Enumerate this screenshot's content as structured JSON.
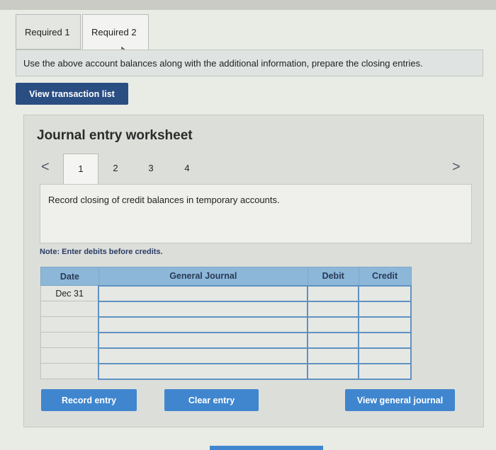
{
  "tabs": [
    {
      "label": "Required 1"
    },
    {
      "label": "Required 2"
    }
  ],
  "instruction": "Use the above account balances along with the additional information, prepare the closing entries.",
  "view_transaction_button": "View transaction list",
  "worksheet": {
    "title": "Journal entry worksheet",
    "nav_prev": "<",
    "nav_next": ">",
    "pages": [
      "1",
      "2",
      "3",
      "4"
    ],
    "active_page": "1",
    "description": "Record closing of credit balances in temporary accounts.",
    "note": "Note: Enter debits before credits."
  },
  "journal": {
    "headers": [
      "Date",
      "General Journal",
      "Debit",
      "Credit"
    ],
    "rows": [
      {
        "date": "Dec 31",
        "account": "",
        "debit": "",
        "credit": ""
      },
      {
        "date": "",
        "account": "",
        "debit": "",
        "credit": ""
      },
      {
        "date": "",
        "account": "",
        "debit": "",
        "credit": ""
      },
      {
        "date": "",
        "account": "",
        "debit": "",
        "credit": ""
      },
      {
        "date": "",
        "account": "",
        "debit": "",
        "credit": ""
      },
      {
        "date": "",
        "account": "",
        "debit": "",
        "credit": ""
      }
    ]
  },
  "buttons": {
    "record": "Record entry",
    "clear": "Clear entry",
    "view_journal": "View general journal"
  },
  "colors": {
    "primary_button": "#3f86cf",
    "dark_button": "#2a4d82",
    "table_header": "#8cb7d9"
  }
}
